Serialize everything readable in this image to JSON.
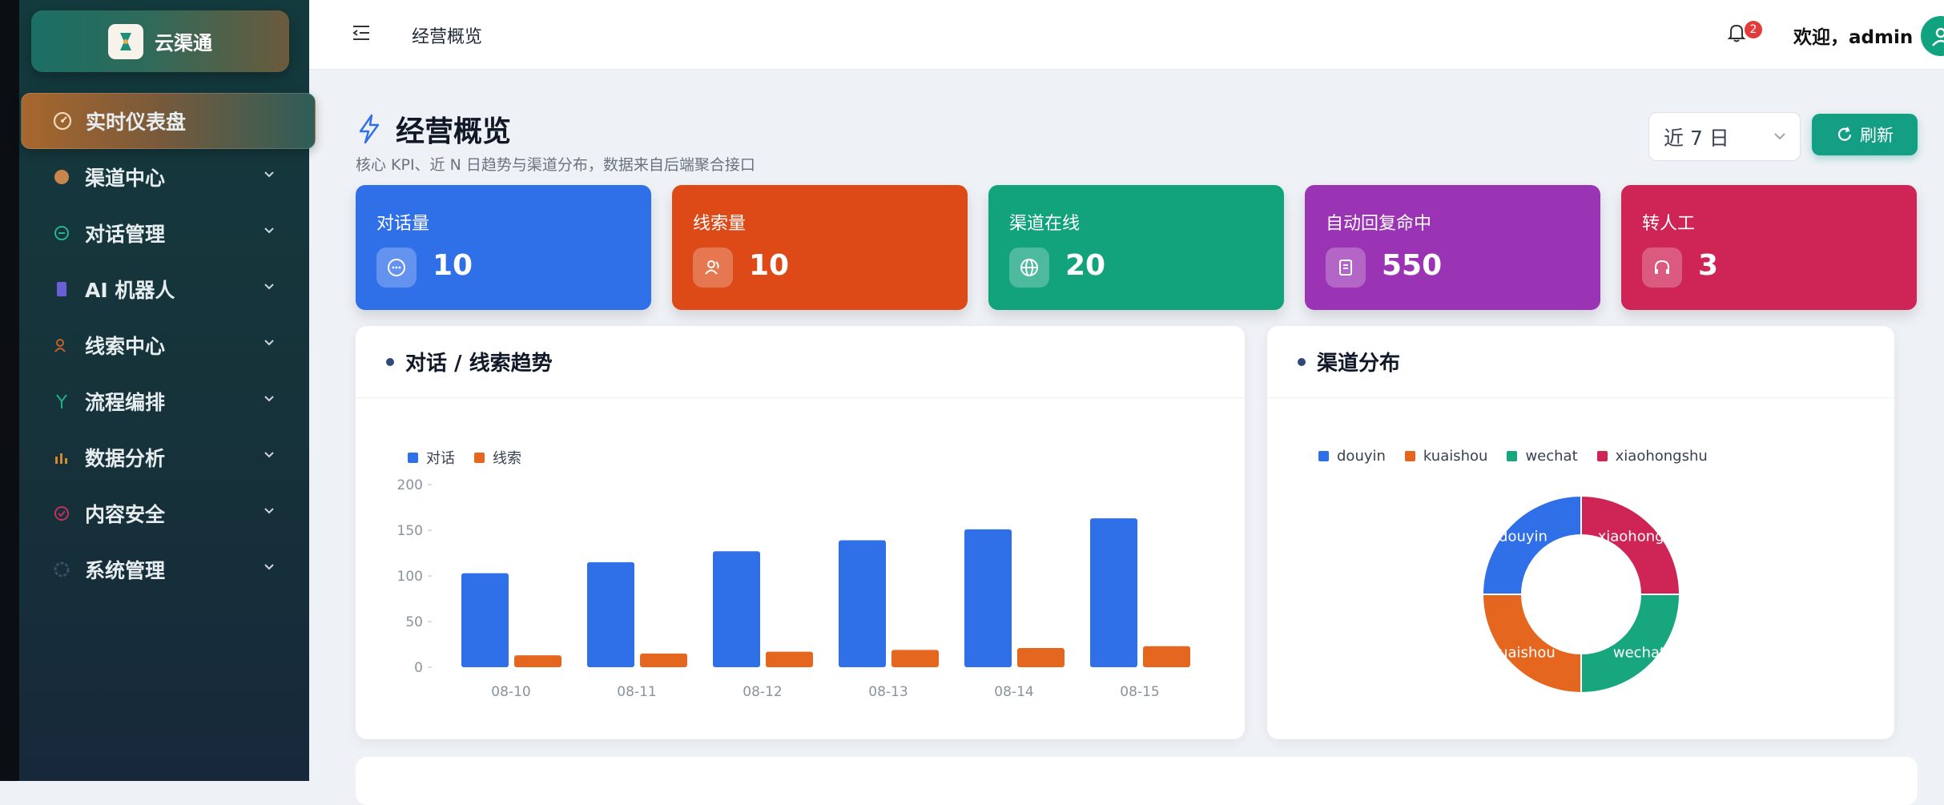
{
  "app": {
    "name": "云渠通"
  },
  "sidebar": {
    "items": [
      {
        "label": "实时仪表盘",
        "active": true,
        "icon": "gauge-icon",
        "color": "#f5d9b8"
      },
      {
        "label": "渠道中心",
        "icon": "channel-icon",
        "color": "#c9864a"
      },
      {
        "label": "对话管理",
        "icon": "chat-icon",
        "color": "#29b38e"
      },
      {
        "label": "AI 机器人",
        "icon": "robot-icon",
        "color": "#6b5fd6"
      },
      {
        "label": "线索中心",
        "icon": "people-icon",
        "color": "#c2622a"
      },
      {
        "label": "流程编排",
        "icon": "flow-icon",
        "color": "#1fb08a"
      },
      {
        "label": "数据分析",
        "icon": "bar-chart-icon",
        "color": "#d08a2a"
      },
      {
        "label": "内容安全",
        "icon": "shield-icon",
        "color": "#c0325a"
      },
      {
        "label": "系统管理",
        "icon": "settings-icon",
        "color": "#3a4e66"
      }
    ]
  },
  "header": {
    "title": "经营概览",
    "notifications": "2",
    "welcome": "欢迎，admin"
  },
  "page": {
    "title": "经营概览",
    "subtitle": "核心 KPI、近 N 日趋势与渠道分布，数据来自后端聚合接口",
    "range": "近 7 日",
    "refresh": "刷新"
  },
  "kpis": [
    {
      "label": "对话量",
      "value": "10",
      "color": "#2f6fe8",
      "icon": "chat-bubble-icon"
    },
    {
      "label": "线索量",
      "value": "10",
      "color": "#dd4a17",
      "icon": "people-icon"
    },
    {
      "label": "渠道在线",
      "value": "20",
      "color": "#12a37c",
      "icon": "globe-icon"
    },
    {
      "label": "自动回复命中",
      "value": "550",
      "color": "#9b33b5",
      "icon": "robot-icon"
    },
    {
      "label": "转人工",
      "value": "3",
      "color": "#cf2456",
      "icon": "headset-icon"
    }
  ],
  "trend": {
    "title": "对话 / 线索趋势",
    "legend": [
      {
        "name": "对话",
        "color": "#2f6fe8"
      },
      {
        "name": "线索",
        "color": "#e5671f"
      }
    ]
  },
  "distribution": {
    "title": "渠道分布",
    "legend": [
      {
        "name": "douyin",
        "color": "#2f6fe8"
      },
      {
        "name": "kuaishou",
        "color": "#e5671f"
      },
      {
        "name": "wechat",
        "color": "#17a67d"
      },
      {
        "name": "xiaohongshu",
        "color": "#cf2456"
      }
    ]
  },
  "chart_data": [
    {
      "type": "bar",
      "title": "对话 / 线索趋势",
      "categories": [
        "08-10",
        "08-11",
        "08-12",
        "08-13",
        "08-14",
        "08-15"
      ],
      "series": [
        {
          "name": "对话",
          "values": [
            103,
            115,
            127,
            139,
            151,
            163
          ]
        },
        {
          "name": "线索",
          "values": [
            13,
            15,
            17,
            19,
            21,
            23
          ]
        }
      ],
      "ylim": [
        0,
        200
      ],
      "yticks": [
        0,
        50,
        100,
        150,
        200
      ],
      "legend": "top-left"
    },
    {
      "type": "pie",
      "title": "渠道分布",
      "labels": [
        "douyin",
        "kuaishou",
        "wechat",
        "xiaohongshu"
      ],
      "values": [
        1,
        1,
        1,
        1
      ],
      "slice_labels": [
        "douyin",
        "kuaishou",
        "wechat",
        "xiaohongsh"
      ],
      "legend": "top"
    }
  ]
}
